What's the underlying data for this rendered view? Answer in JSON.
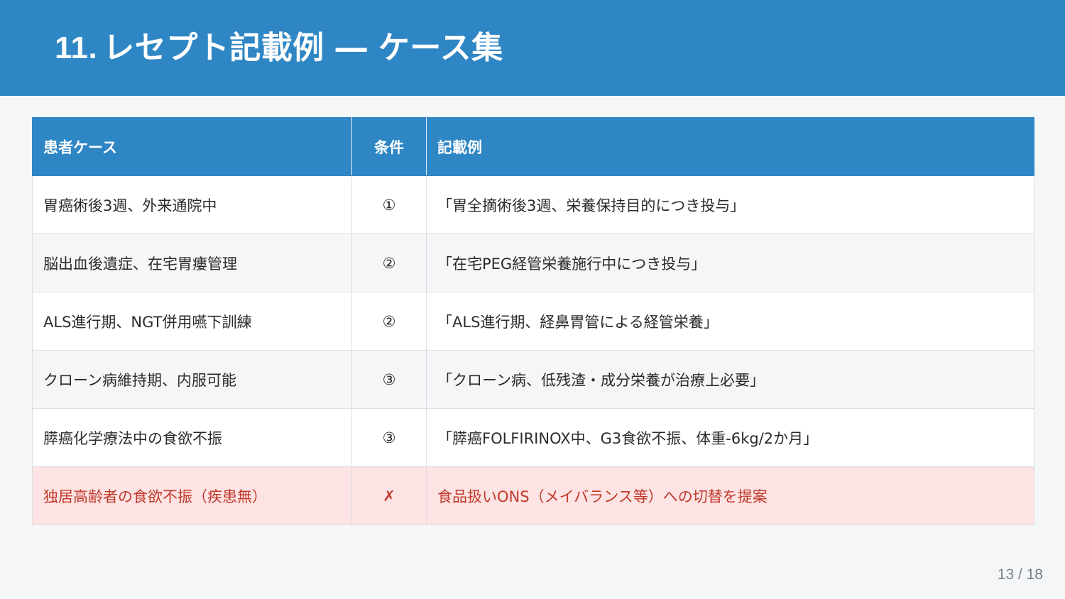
{
  "slide": {
    "number": "11.",
    "title": "レセプト記載例 ― ケース集"
  },
  "table": {
    "headers": [
      "患者ケース",
      "条件",
      "記載例"
    ],
    "rows": [
      {
        "case": "胃癌術後3週、外来通院中",
        "condition": "①",
        "example": "「胃全摘術後3週、栄養保持目的につき投与」",
        "highlight": false
      },
      {
        "case": "脳出血後遺症、在宅胃瘻管理",
        "condition": "②",
        "example": "「在宅PEG経管栄養施行中につき投与」",
        "highlight": false
      },
      {
        "case": "ALS進行期、NGT併用嚥下訓練",
        "condition": "②",
        "example": "「ALS進行期、経鼻胃管による経管栄養」",
        "highlight": false
      },
      {
        "case": "クローン病維持期、内服可能",
        "condition": "③",
        "example": "「クローン病、低残渣・成分栄養が治療上必要」",
        "highlight": false
      },
      {
        "case": "膵癌化学療法中の食欲不振",
        "condition": "③",
        "example": "「膵癌FOLFIRINOX中、G3食欲不振、体重-6kg/2か月」",
        "highlight": false
      },
      {
        "case": "独居高齢者の食欲不振（疾患無）",
        "condition": "✗",
        "example": "食品扱いONS（メイバランス等）への切替を提案",
        "highlight": true
      }
    ]
  },
  "pager": "13 / 18",
  "colors": {
    "accent": "#2f86c4",
    "warning_bg": "#fde3e3",
    "warning_text": "#c0392b"
  }
}
